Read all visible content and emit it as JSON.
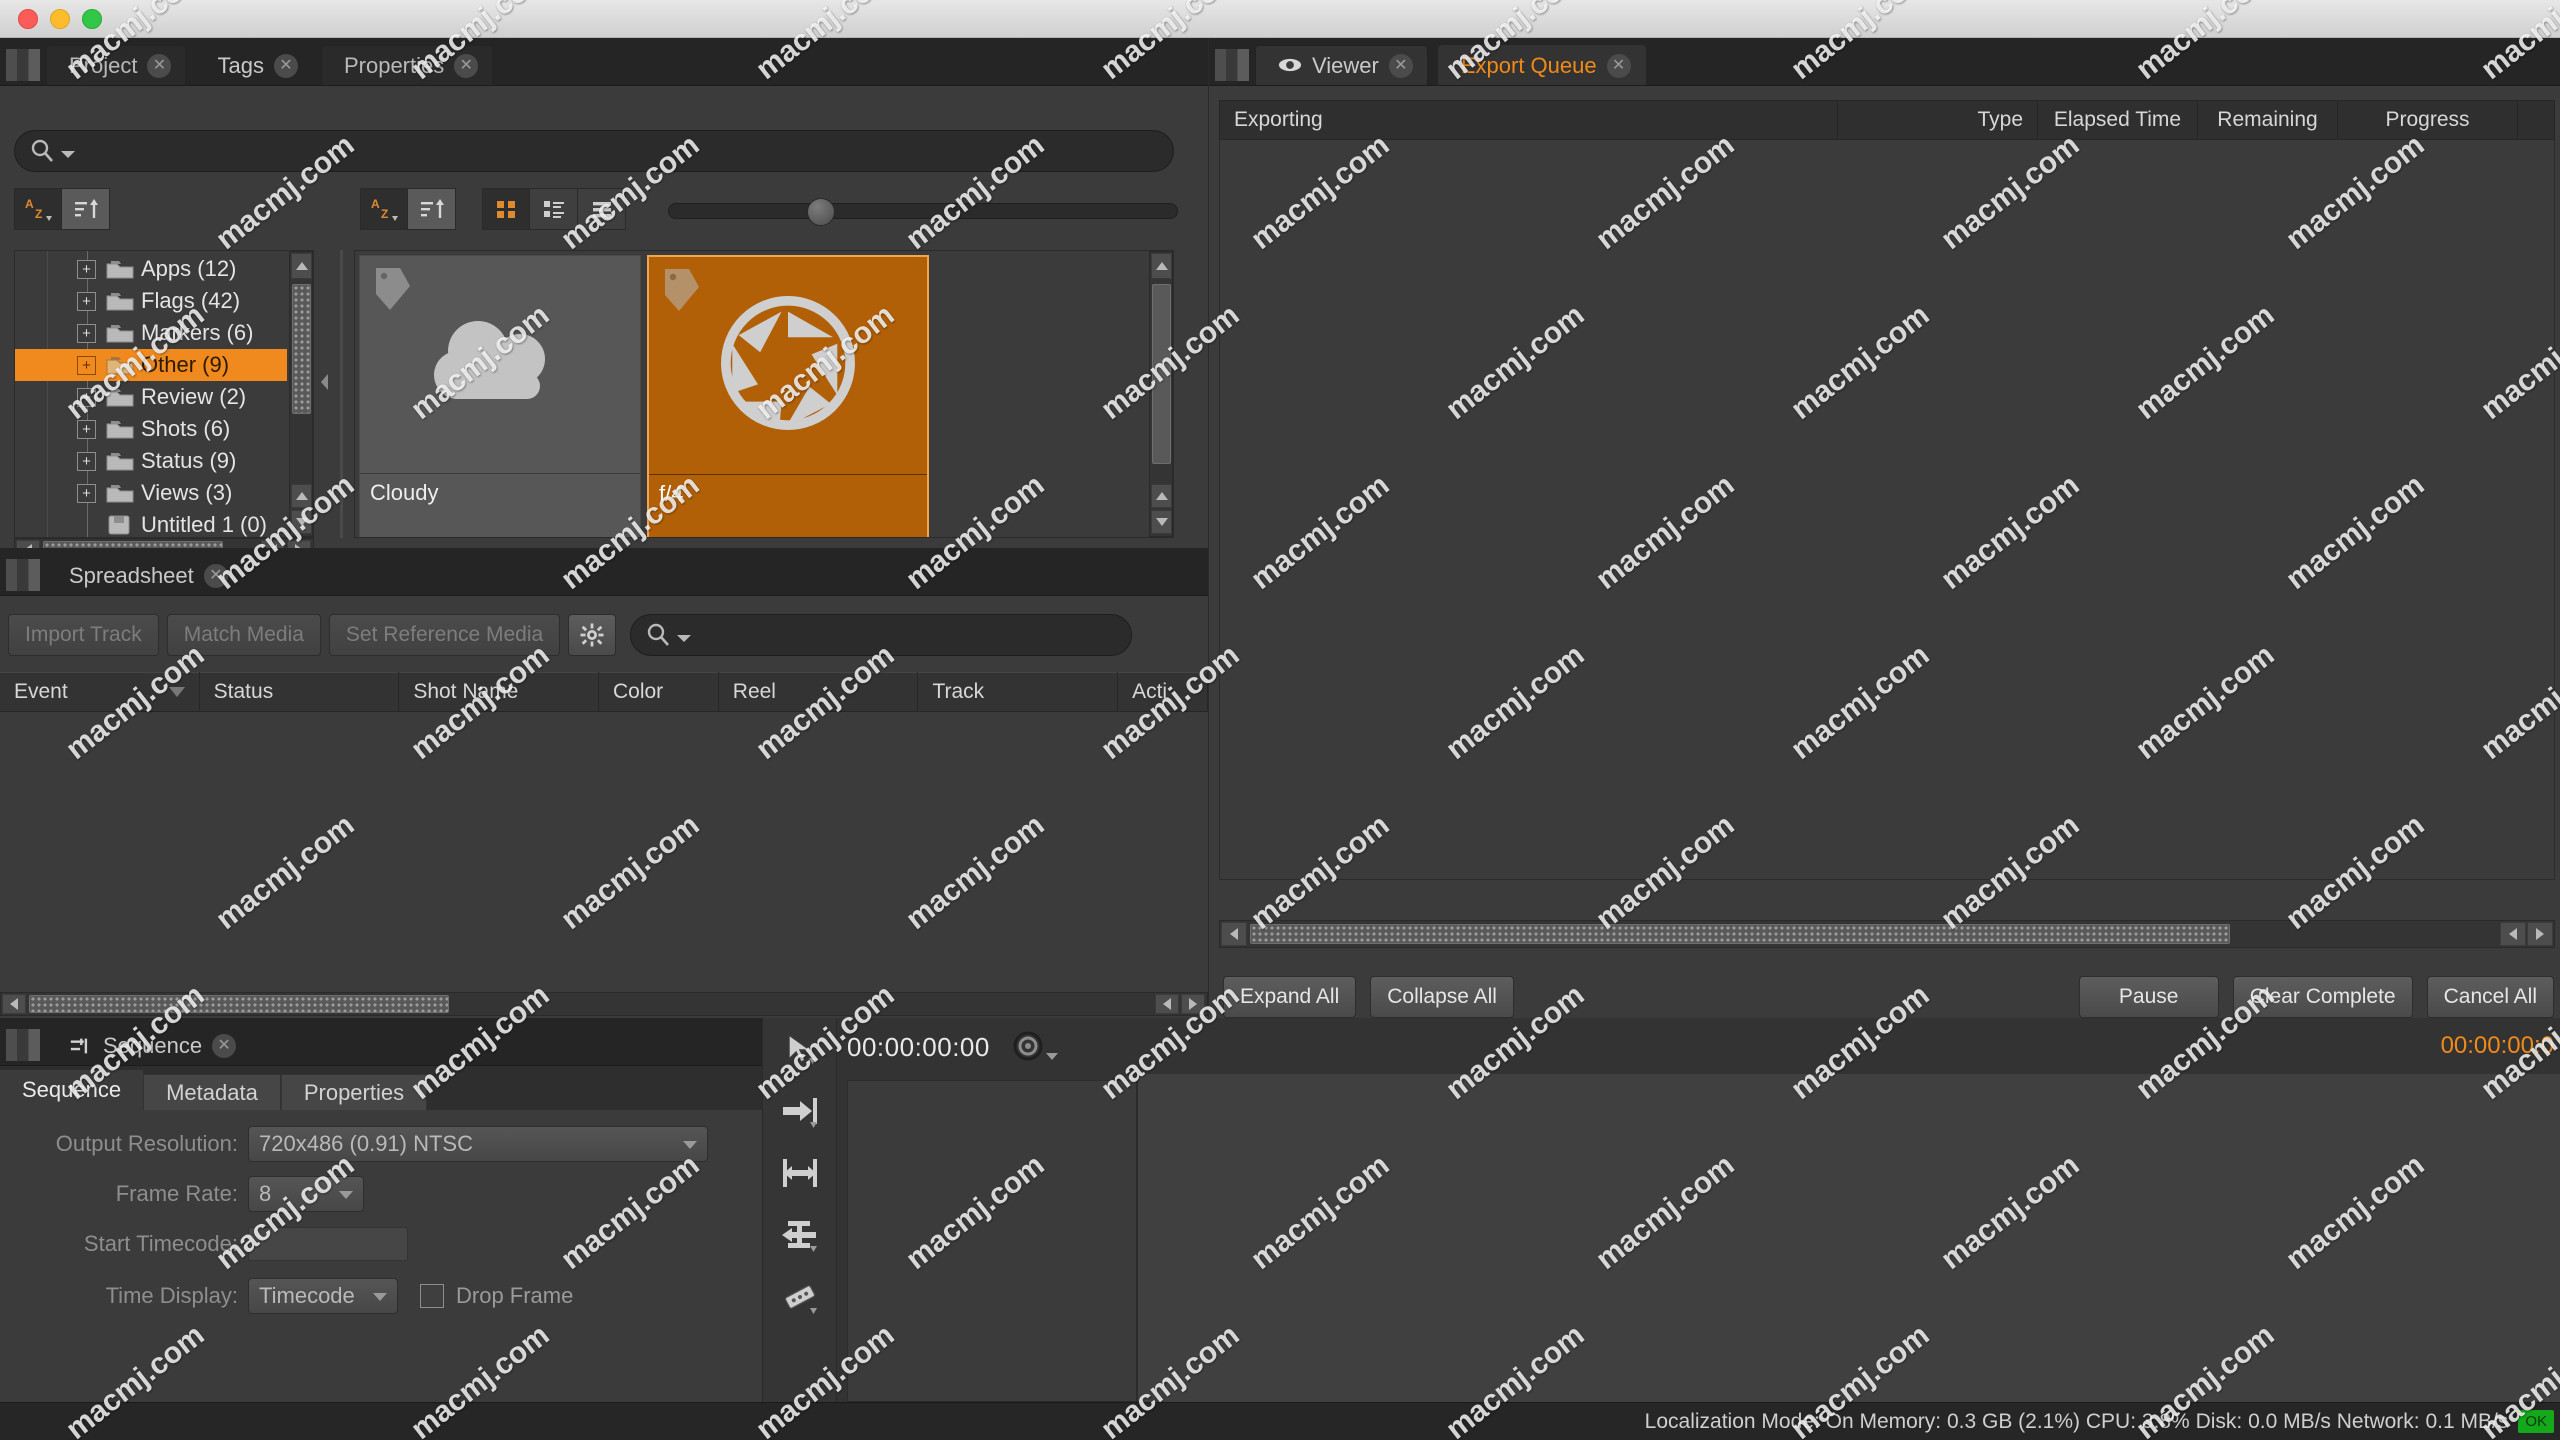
{
  "window": {
    "traffic_lights": [
      "close",
      "minimize",
      "zoom"
    ]
  },
  "left_top_panel": {
    "tabs": [
      {
        "label": "Project",
        "active": false,
        "closable": true
      },
      {
        "label": "Tags",
        "active": true,
        "closable": true
      },
      {
        "label": "Properties",
        "active": false,
        "closable": true
      }
    ],
    "search": {
      "placeholder": "",
      "value": "",
      "icon": "search-icon"
    },
    "sort_buttons": [
      {
        "icon": "sort-alpha-icon",
        "active": false
      },
      {
        "icon": "sort-order-icon",
        "active": true
      }
    ],
    "view_buttons": [
      {
        "icon": "grid-view-icon",
        "active": true
      },
      {
        "icon": "detail-list-icon",
        "active": false
      },
      {
        "icon": "list-view-icon",
        "active": false
      }
    ],
    "zoom_slider": {
      "value": 18
    },
    "tree": [
      {
        "label": "Apps (12)",
        "expandable": true,
        "selected": false,
        "icon": "folder-icon"
      },
      {
        "label": "Flags (42)",
        "expandable": true,
        "selected": false,
        "icon": "folder-icon"
      },
      {
        "label": "Markers (6)",
        "expandable": true,
        "selected": false,
        "icon": "folder-icon"
      },
      {
        "label": "Other (9)",
        "expandable": true,
        "selected": true,
        "icon": "folder-icon"
      },
      {
        "label": "Review (2)",
        "expandable": true,
        "selected": false,
        "icon": "folder-icon"
      },
      {
        "label": "Shots (6)",
        "expandable": true,
        "selected": false,
        "icon": "folder-icon"
      },
      {
        "label": "Status (9)",
        "expandable": true,
        "selected": false,
        "icon": "folder-icon"
      },
      {
        "label": "Views (3)",
        "expandable": true,
        "selected": false,
        "icon": "folder-icon"
      },
      {
        "label": "Untitled 1 (0)",
        "expandable": false,
        "selected": false,
        "icon": "bin-icon"
      }
    ],
    "thumbnails": [
      {
        "label": "Cloudy",
        "icon": "cloud-icon",
        "selected": false
      },
      {
        "label": "f/4",
        "icon": "aperture-icon",
        "selected": true
      }
    ]
  },
  "spreadsheet_panel": {
    "tabs": [
      {
        "label": "Spreadsheet",
        "active": true,
        "closable": true
      }
    ],
    "toolbar": {
      "import_track": "Import Track",
      "match_media": "Match Media",
      "set_reference_media": "Set Reference Media",
      "settings_icon": "gear-icon",
      "search": {
        "placeholder": "",
        "value": "",
        "icon": "search-icon"
      }
    },
    "columns": [
      "Event",
      "Status",
      "Shot Name",
      "Color",
      "Reel",
      "Track",
      "Acti"
    ],
    "rows": []
  },
  "export_queue_panel": {
    "tabs": [
      {
        "label": "Viewer",
        "active": false,
        "closable": true,
        "icon": "eye-icon"
      },
      {
        "label": "Export Queue",
        "active": true,
        "closable": true
      }
    ],
    "columns": [
      "Exporting",
      "Type",
      "Elapsed Time",
      "Remaining",
      "Progress"
    ],
    "rows": [],
    "buttons_left": [
      "Expand All",
      "Collapse All"
    ],
    "buttons_right": [
      "Pause",
      "Clear Complete",
      "Cancel All"
    ]
  },
  "sequence_panel": {
    "tabs": [
      {
        "label": "Sequence",
        "active": true,
        "closable": true,
        "icon": "sequence-icon"
      }
    ],
    "subtabs": [
      {
        "label": "Sequence",
        "active": true
      },
      {
        "label": "Metadata",
        "active": false
      },
      {
        "label": "Properties",
        "active": false
      }
    ],
    "fields": [
      {
        "label": "Output Resolution:",
        "value": "720x486 (0.91) NTSC",
        "type": "combo"
      },
      {
        "label": "Frame Rate:",
        "value": "8",
        "type": "combo"
      },
      {
        "label": "Start Timecode:",
        "value": "",
        "type": "text"
      },
      {
        "label": "Time Display:",
        "value": "Timecode",
        "type": "combo"
      }
    ],
    "checkbox": {
      "label": "Drop Frame",
      "checked": false
    }
  },
  "timeline_panel": {
    "tools": [
      {
        "icon": "select-arrow-icon"
      },
      {
        "icon": "move-trim-icon"
      },
      {
        "icon": "slip-icon"
      },
      {
        "icon": "roll-icon"
      },
      {
        "icon": "razor-icon"
      }
    ],
    "playhead_timecode": "00:00:00:00",
    "record_icon": "record-target-icon",
    "right_timecode": "00:00:00:0"
  },
  "status_bar": {
    "text": "Localization Mode: On  Memory: 0.3 GB (2.1%)  CPU: 3.8%  Disk: 0.0 MB/s  Network: 0.1 MB/s",
    "badge": "OK",
    "badge_color": "#16a81b"
  },
  "colors": {
    "accent": "#f08a1e",
    "panel_bg": "#3b3b3b",
    "dark_bg": "#252525",
    "selected_thumb": "#b26008"
  },
  "watermarks": [
    "macmj.com"
  ]
}
